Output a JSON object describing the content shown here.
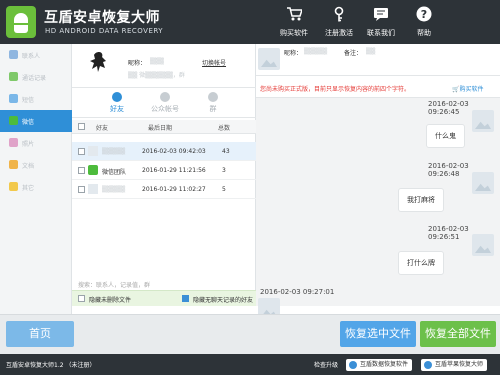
{
  "header": {
    "title": "互盾安卓恢复大师",
    "subtitle": "HD ANDROID DATA RECOVERY",
    "buttons": [
      {
        "label": "购买软件",
        "icon": "cart-icon"
      },
      {
        "label": "注册激活",
        "icon": "key-icon"
      },
      {
        "label": "联系我们",
        "icon": "chat-icon"
      },
      {
        "label": "帮助",
        "icon": "help-icon"
      }
    ],
    "colors": {
      "bg": "#2d3338",
      "accent": "#2f8fd7",
      "logo": "#6bbf3b"
    }
  },
  "sidebar": {
    "items": [
      {
        "label": "联系人",
        "icon": "contacts-icon",
        "color": "#8fb6e0"
      },
      {
        "label": "通话记录",
        "icon": "phone-icon",
        "color": "#7fc96a"
      },
      {
        "label": "短信",
        "icon": "sms-icon",
        "color": "#7ab7e8"
      },
      {
        "label": "微信",
        "icon": "wechat-icon",
        "color": "#4dbb3c",
        "active": true
      },
      {
        "label": "照片",
        "icon": "photo-icon",
        "color": "#e0a3c9"
      },
      {
        "label": "文档",
        "icon": "document-icon",
        "color": "#f0b44a"
      },
      {
        "label": "其它",
        "icon": "other-icon",
        "color": "#f2c94c"
      }
    ]
  },
  "contacts": {
    "profile": {
      "nick_label": "昵称：",
      "nick_value": "▒▒▒",
      "wechat_value": "▒▒ 微▒▒▒▒▒▒，群",
      "switch_label": "切换帐号"
    },
    "tabs": [
      {
        "label": "好友",
        "icon": "user-icon",
        "active": true
      },
      {
        "label": "公众帐号",
        "icon": "official-account-icon"
      },
      {
        "label": "群",
        "icon": "group-icon"
      }
    ],
    "columns": [
      "好友",
      "最后日期",
      "总数"
    ],
    "rows": [
      {
        "name": "▒▒▒▒▒",
        "date": "2016-02-03 09:42:03",
        "count": "43",
        "selected": true,
        "badge": false
      },
      {
        "name": "微信团队",
        "date": "2016-01-29 11:21:56",
        "count": "3",
        "selected": false,
        "badge": true
      },
      {
        "name": "▒▒▒▒▒",
        "date": "2016-01-29 11:02:27",
        "count": "5",
        "selected": false,
        "badge": false
      }
    ],
    "search_placeholder": "搜索：联系人，记录值，群",
    "filter_hide_deleted": "隐藏未删除文件",
    "filter_hide_nochat": "隐藏无聊天记录的好友"
  },
  "chat": {
    "top": {
      "nick_label": "昵称：",
      "nick_value": "▒▒▒▒▒",
      "note_label": "备注：",
      "note_value": "▒▒"
    },
    "notice_text": "您尚未购买正式版，目前只显示恢复内容的前四个字符。",
    "buy_label": "购买软件",
    "messages": [
      {
        "time": "2016-02-03 09:26:45",
        "text": "什么鬼",
        "side": "right"
      },
      {
        "time": "2016-02-03 09:26:48",
        "text": "我打麻将",
        "side": "right"
      },
      {
        "time": "2016-02-03 09:26:51",
        "text": "打什么牌",
        "side": "right"
      },
      {
        "time": "2016-02-03 09:27:01",
        "text": "",
        "side": "left"
      }
    ]
  },
  "bottom": {
    "home_label": "首页",
    "recover_selected_label": "恢复选中文件",
    "recover_all_label": "恢复全部文件"
  },
  "status": {
    "app_version": "互盾安卓恢复大师1.2 （未注册）",
    "check_update": "检查升级",
    "product1": "互盾数据恢复软件",
    "product2": "互盾苹果恢复大师"
  }
}
